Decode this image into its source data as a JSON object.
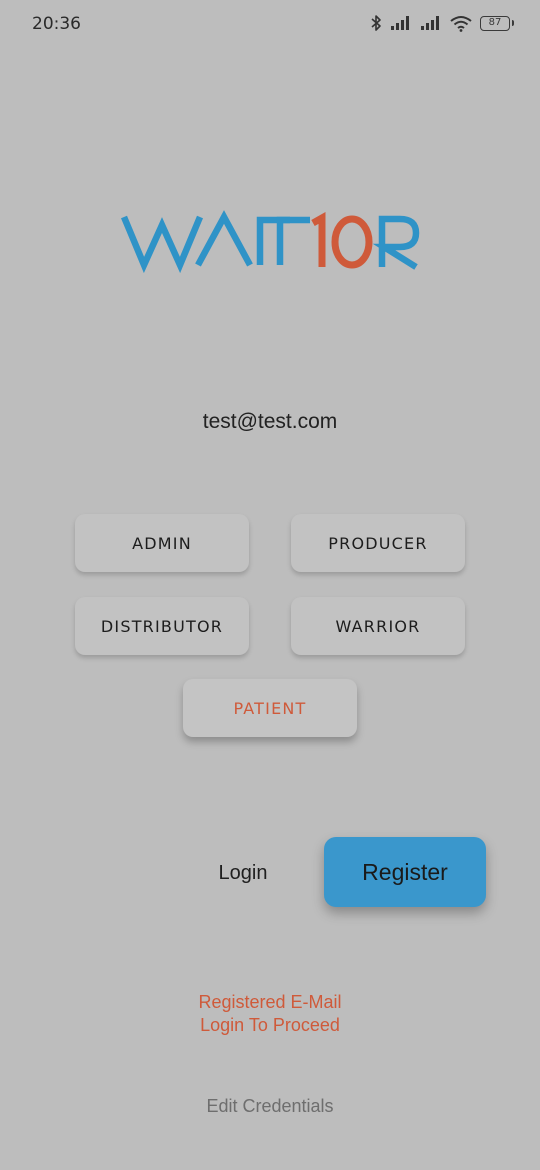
{
  "status_bar": {
    "time": "20:36",
    "battery_level": "87",
    "icons": [
      "bluetooth-icon",
      "signal-icon",
      "signal-icon",
      "wifi-icon",
      "battery-icon"
    ]
  },
  "logo": {
    "text_part1": "WARR",
    "text_part2": "10",
    "text_part3": "R",
    "colors": {
      "blue": "#2f93c7",
      "orange": "#cf5a3a"
    }
  },
  "user": {
    "email": "test@test.com"
  },
  "roles": {
    "admin": "ADMIN",
    "producer": "PRODUCER",
    "distributor": "DISTRIBUTOR",
    "warrior": "WARRIOR",
    "patient": "PATIENT"
  },
  "actions": {
    "login": "Login",
    "register": "Register"
  },
  "message": {
    "line1": "Registered E-Mail",
    "line2": "Login To Proceed"
  },
  "footer": {
    "edit_credentials": "Edit Credentials"
  },
  "theme": {
    "background": "#bdbdbd",
    "accent_blue": "#3a97cc",
    "accent_orange": "#cf5a3a"
  }
}
